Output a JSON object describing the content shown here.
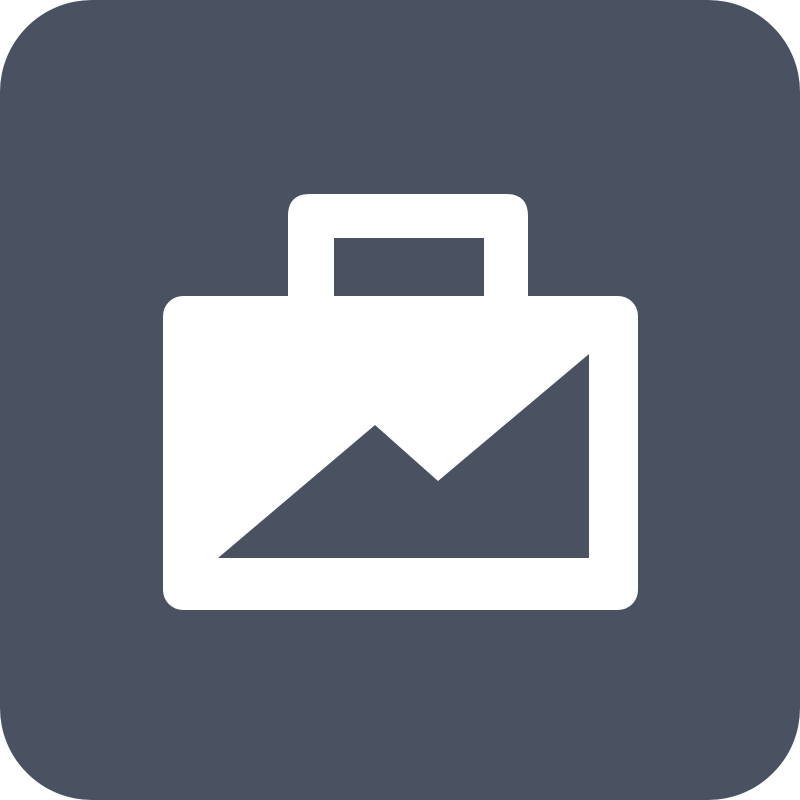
{
  "icon": {
    "name": "briefcase-chart-icon",
    "background_color": "#4a5160",
    "glyph_color": "#ffffff",
    "cutout_color": "#4a5160"
  }
}
